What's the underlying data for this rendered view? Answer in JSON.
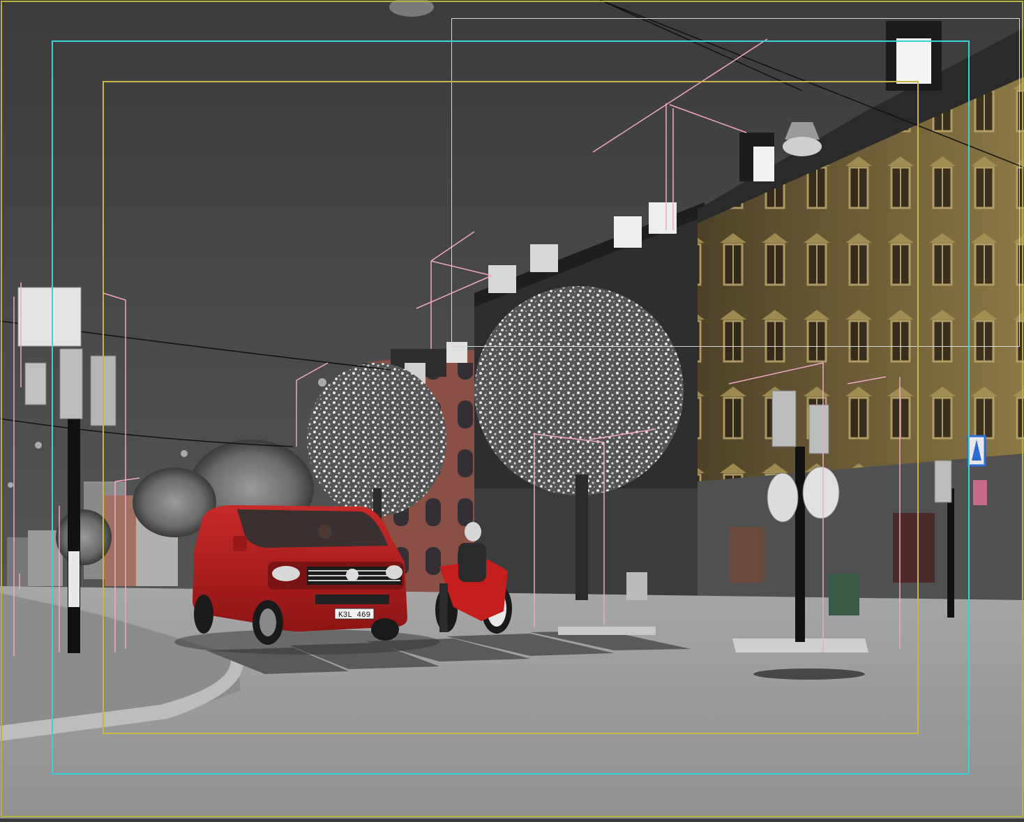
{
  "viewport": {
    "van": {
      "plate": "K3L 469"
    }
  },
  "colors": {
    "sky": "#3f3f3f",
    "road": "#9e9e9e",
    "sidewalk": "#8f8f8f",
    "van_red": "#b21d1f",
    "building_yellow": "#7f6d3e",
    "building_brick": "#8a5046",
    "safe_frame_yellow": "#c9b543",
    "safe_frame_cyan": "#3fd0d6",
    "helper_pink": "#f2a7c6"
  },
  "icons": {
    "crosswalk_sign": "pedestrian-crossing-icon"
  }
}
